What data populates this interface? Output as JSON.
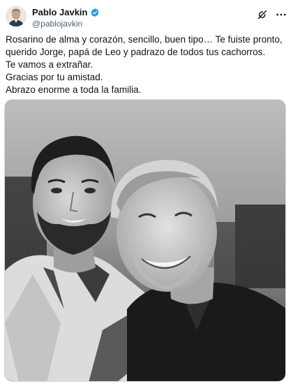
{
  "author": {
    "name": "Pablo Javkin",
    "handle": "@pablojavkin",
    "verified": true
  },
  "header_icons": [
    "grok-icon",
    "more-icon"
  ],
  "tweet": {
    "lines": [
      "Rosarino de alma y corazón, sencillo, buen tipo… Te fuiste pronto,",
      "querido Jorge, papá de Leo y padrazo de todos tus cachorros.",
      "Te vamos a extrañar.",
      "Gracias por tu amistad.",
      "Abrazo enorme a toda la familia."
    ]
  },
  "media": {
    "type": "photo",
    "style": "black-and-white"
  },
  "colors": {
    "text": "#0f1419",
    "secondary": "#536471",
    "verified": "#1d9bf0",
    "border": "#cfd9de"
  }
}
